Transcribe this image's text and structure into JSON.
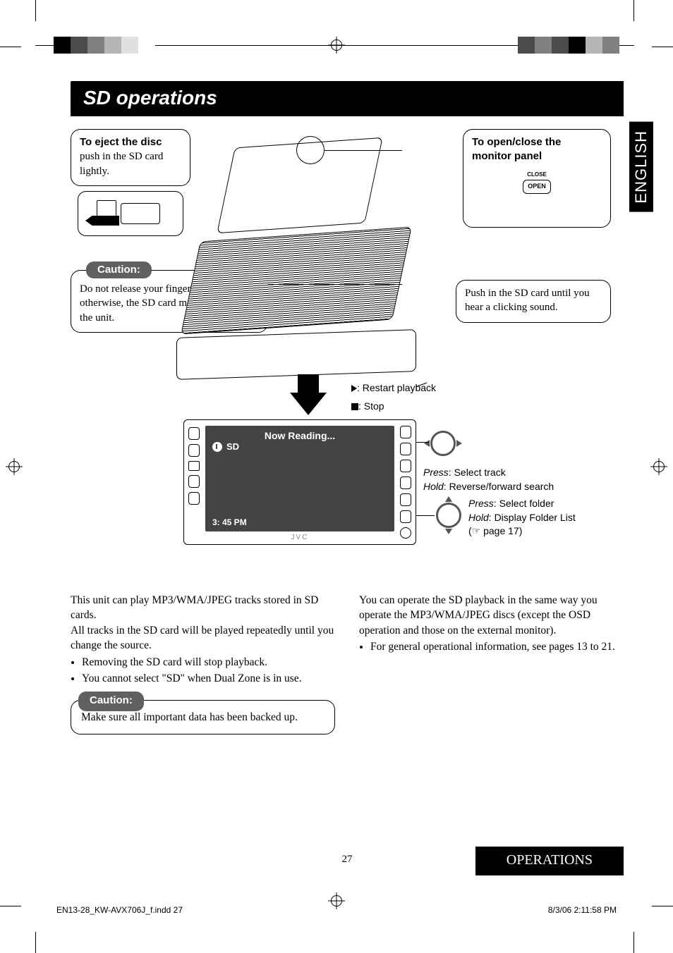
{
  "header": {
    "title": "SD operations"
  },
  "lang_tab": "ENGLISH",
  "callouts": {
    "eject": {
      "title": "To eject the disc",
      "body": "push in the SD card lightly."
    },
    "open_close": {
      "title": "To open/close the monitor panel",
      "btn_top": "CLOSE",
      "btn_main": "OPEN"
    },
    "caution_top_label": "Caution:",
    "caution_top_body": "Do not release your finger quickly; otherwise, the SD card may pop out from the unit.",
    "push_in": "Push in the SD card until you hear a clicking sound."
  },
  "screen": {
    "now_reading": "Now Reading...",
    "source": "SD",
    "time": "3: 45 PM",
    "brand": "JVC"
  },
  "legend": {
    "restart": ": Restart playback",
    "stop": ": Stop",
    "track_press_label": "Press",
    "track_press": ":  Select track",
    "track_hold_label": "Hold",
    "track_hold": ":   Reverse/forward search",
    "folder_press_label": "Press",
    "folder_press": ":   Select folder",
    "folder_hold_label": "Hold",
    "folder_hold": ":    Display Folder List",
    "folder_ref": "(☞ page 17)"
  },
  "body": {
    "left": {
      "p1": "This unit can play MP3/WMA/JPEG tracks stored in SD cards.",
      "p2": "All tracks in the SD card will be played repeatedly until you change the source.",
      "li1": "Removing the SD card will stop playback.",
      "li2": "You cannot select \"SD\" when Dual Zone is in use."
    },
    "right": {
      "p1": "You can operate the SD playback in the same way you operate the MP3/WMA/JPEG discs (except the OSD operation and those on the external monitor).",
      "li1": "For general operational information, see pages 13 to 21."
    }
  },
  "caution_lower": {
    "label": "Caution:",
    "body": "Make sure all important data has been backed up."
  },
  "footer": {
    "page_number": "27",
    "section": "OPERATIONS"
  },
  "imprint": {
    "file": "EN13-28_KW-AVX706J_f.indd   27",
    "stamp": "8/3/06   2:11:58 PM"
  },
  "color_bars": {
    "left": [
      "#000000",
      "#4b4b4b",
      "#808080",
      "#b5b5b5",
      "#e0e0e0",
      "#ffffff"
    ],
    "right": [
      "#4b4b4b",
      "#808080",
      "#4b4b4b",
      "#000000",
      "#b5b5b5",
      "#808080"
    ]
  }
}
